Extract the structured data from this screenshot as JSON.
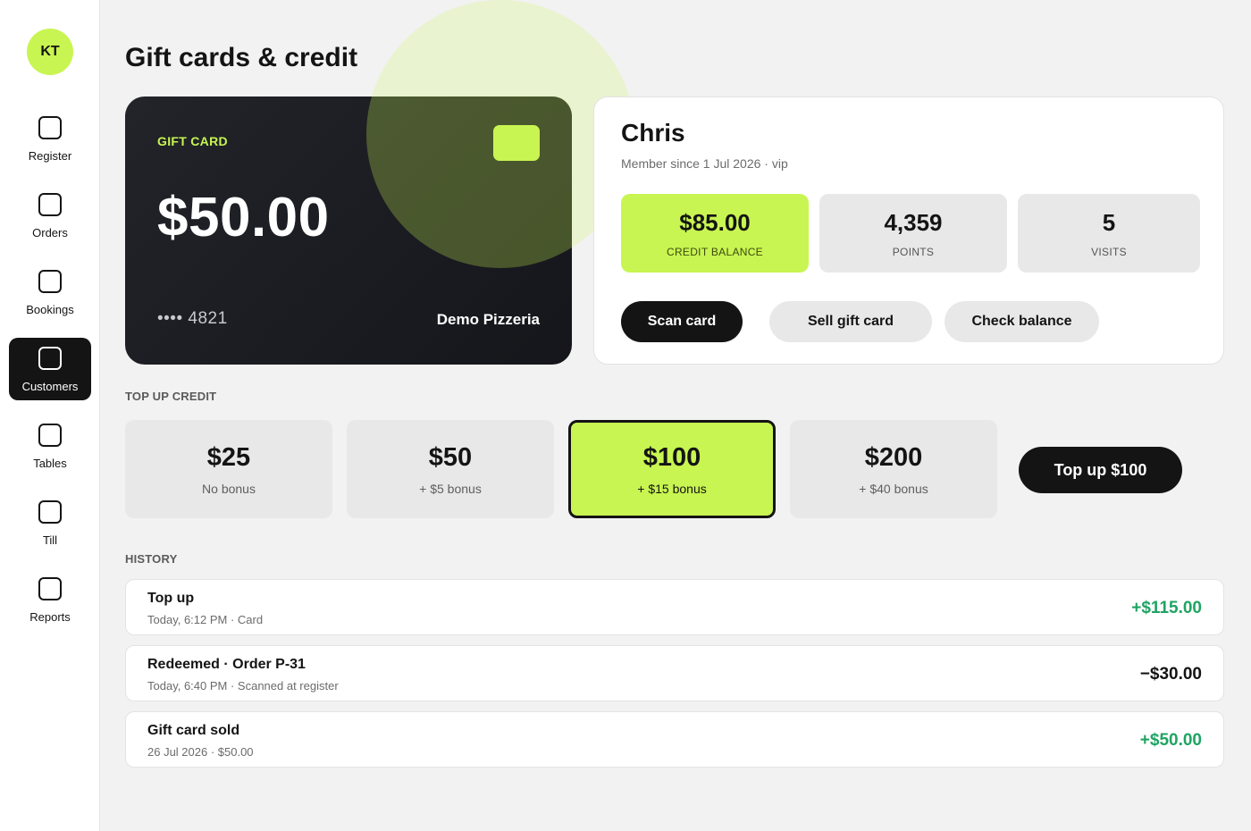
{
  "sidebar": {
    "avatar_initials": "KT",
    "items": [
      {
        "label": "Register",
        "icon": "register-icon"
      },
      {
        "label": "Orders",
        "icon": "orders-icon"
      },
      {
        "label": "Bookings",
        "icon": "bookings-icon"
      },
      {
        "label": "Customers",
        "icon": "customers-icon",
        "active": true
      },
      {
        "label": "Tables",
        "icon": "tables-icon"
      },
      {
        "label": "Till",
        "icon": "till-icon"
      },
      {
        "label": "Reports",
        "icon": "reports-icon"
      }
    ]
  },
  "page": {
    "title": "Gift cards & credit"
  },
  "gift_card": {
    "kind_label": "GIFT CARD",
    "amount": "$50.00",
    "number": "•••• 4821",
    "merchant": "Demo Pizzeria"
  },
  "customer": {
    "name": "Chris",
    "meta": "Member since 1 Jul 2026 · vip",
    "stats": [
      {
        "value": "$85.00",
        "label": "CREDIT BALANCE"
      },
      {
        "value": "4,359",
        "label": "POINTS"
      },
      {
        "value": "5",
        "label": "VISITS"
      }
    ],
    "actions": {
      "scan": "Scan card",
      "sell": "Sell gift card",
      "check": "Check balance"
    }
  },
  "topup": {
    "section_label": "TOP UP CREDIT",
    "options": [
      {
        "amount": "$25",
        "bonus": "No bonus"
      },
      {
        "amount": "$50",
        "bonus": "+ $5 bonus"
      },
      {
        "amount": "$100",
        "bonus": "+ $15 bonus",
        "selected": true
      },
      {
        "amount": "$200",
        "bonus": "+ $40 bonus"
      }
    ],
    "action_label": "Top up $100"
  },
  "history": {
    "section_label": "HISTORY",
    "rows": [
      {
        "title": "Top up",
        "sub": "Today, 6:12 PM · Card",
        "amount": "+$115.00",
        "positive": true
      },
      {
        "title": "Redeemed · Order P-31",
        "sub": "Today, 6:40 PM · Scanned at register",
        "amount": "−$30.00",
        "positive": false
      },
      {
        "title": "Gift card sold",
        "sub": "26 Jul 2026 · $50.00",
        "amount": "+$50.00",
        "positive": true
      }
    ]
  },
  "colors": {
    "accent": "#c8f551",
    "dark": "#141414",
    "positive": "#1fa463"
  }
}
